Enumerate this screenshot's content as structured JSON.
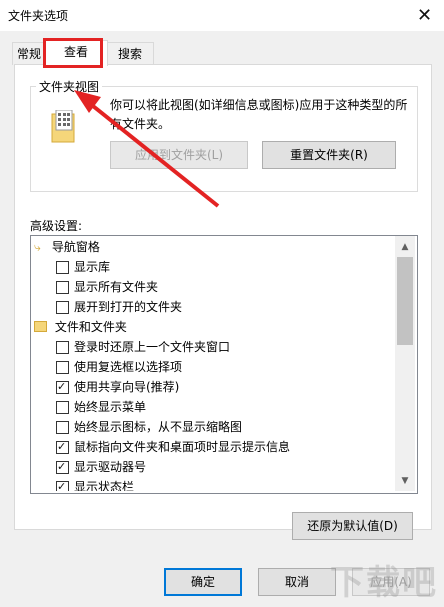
{
  "window": {
    "title": "文件夹选项",
    "close_glyph": "✕"
  },
  "tabs": [
    {
      "label": "常规"
    },
    {
      "label": "查看"
    },
    {
      "label": "搜索"
    }
  ],
  "folder_views": {
    "group_label": "文件夹视图",
    "description": "你可以将此视图(如详细信息或图标)应用于这种类型的所有文件夹。",
    "apply_button": "应用到文件夹(L)",
    "reset_button": "重置文件夹(R)"
  },
  "advanced": {
    "label": "高级设置:",
    "items": [
      {
        "kind": "category",
        "label": "导航窗格",
        "icon": "nav-pane-icon"
      },
      {
        "kind": "checkbox",
        "label": "显示库",
        "checked": false
      },
      {
        "kind": "checkbox",
        "label": "显示所有文件夹",
        "checked": false
      },
      {
        "kind": "checkbox",
        "label": "展开到打开的文件夹",
        "checked": false
      },
      {
        "kind": "category",
        "label": "文件和文件夹",
        "icon": "folder-icon"
      },
      {
        "kind": "checkbox",
        "label": "登录时还原上一个文件夹窗口",
        "checked": false
      },
      {
        "kind": "checkbox",
        "label": "使用复选框以选择项",
        "checked": false
      },
      {
        "kind": "checkbox",
        "label": "使用共享向导(推荐)",
        "checked": true
      },
      {
        "kind": "checkbox",
        "label": "始终显示菜单",
        "checked": false
      },
      {
        "kind": "checkbox",
        "label": "始终显示图标，从不显示缩略图",
        "checked": false
      },
      {
        "kind": "checkbox",
        "label": "鼠标指向文件夹和桌面项时显示提示信息",
        "checked": true
      },
      {
        "kind": "checkbox",
        "label": "显示驱动器号",
        "checked": true
      },
      {
        "kind": "checkbox",
        "label": "显示状态栏",
        "checked": true
      }
    ],
    "restore_button": "还原为默认值(D)"
  },
  "footer": {
    "ok": "确定",
    "cancel": "取消",
    "apply": "应用(A)"
  },
  "annotation_color": "#e32323",
  "watermark": "下载吧"
}
